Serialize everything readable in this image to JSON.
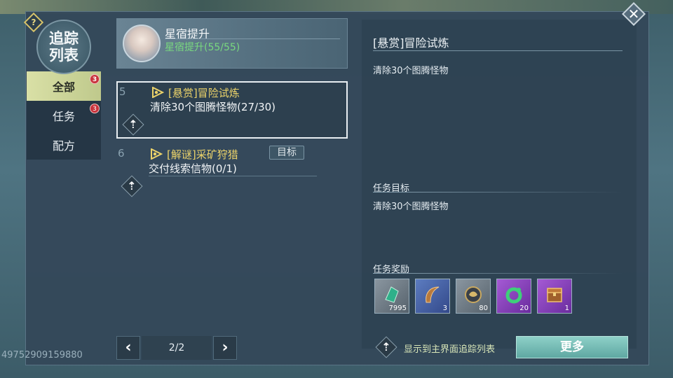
{
  "window": {
    "title": "追踪列表",
    "uid": "49752909159880"
  },
  "colors": {
    "accent_green": "#79d97f",
    "quest_title": "#ecd36a",
    "badge_red": "#c8333c"
  },
  "sidebar": {
    "items": [
      {
        "label": "全部",
        "badge": "3",
        "active": true
      },
      {
        "label": "任务",
        "badge": "3",
        "active": false
      },
      {
        "label": "配方",
        "badge": null,
        "active": false
      }
    ]
  },
  "header_card": {
    "title": "星宿提升",
    "subtitle": "星宿提升(55/55)"
  },
  "quests": [
    {
      "num": "5",
      "title": "[悬赏]冒险试炼",
      "desc": "清除30个图腾怪物(27/30)",
      "selected": true
    },
    {
      "num": "6",
      "title": "[解谜]采矿狩猎",
      "desc": "交付线索信物(0/1)",
      "selected": false,
      "goal_label": "目标"
    }
  ],
  "pager": {
    "prev_icon": "chevron-left-icon",
    "label": "2/2",
    "next_icon": "chevron-right-icon"
  },
  "detail": {
    "title": "[悬赏]冒险试炼",
    "desc": "清除30个图腾怪物",
    "objective_header": "任务目标",
    "objective": "清除30个图腾怪物",
    "reward_header": "任务奖励",
    "rewards": [
      {
        "icon": "green-gem-item-icon",
        "count": "7995",
        "rarity": "gray"
      },
      {
        "icon": "horn-item-icon",
        "count": "3",
        "rarity": "blue"
      },
      {
        "icon": "dragon-plate-item-icon",
        "count": "80",
        "rarity": "gray"
      },
      {
        "icon": "jade-ring-item-icon",
        "count": "20",
        "rarity": "purple"
      },
      {
        "icon": "treasure-chest-item-icon",
        "count": "1",
        "rarity": "purple"
      }
    ]
  },
  "footer": {
    "track_label": "显示到主界面追踪列表",
    "more_label": "更多"
  }
}
